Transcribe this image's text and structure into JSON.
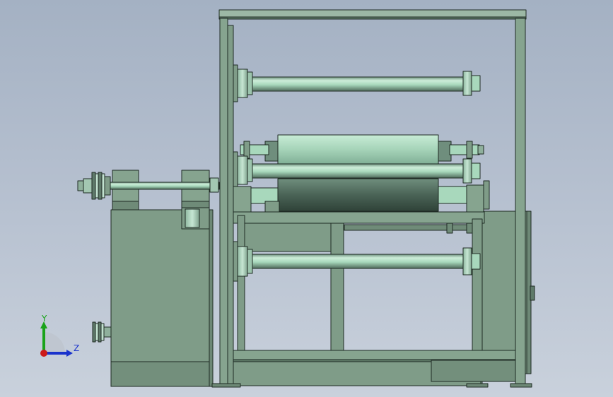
{
  "scene": {
    "name": "slitting-rewinding-machine-side-view"
  },
  "triad": {
    "y_label": "Y",
    "z_label": "Z",
    "colors": {
      "y": "#1aa31a",
      "z": "#1a33cc",
      "x": "#cc1a1a"
    }
  },
  "palette": {
    "body": "#7f9c88",
    "body_dark": "#5e7a67",
    "roller": "#a8d8bc",
    "roller_light": "#cdeed9",
    "roller_dark": "#4f6b5b",
    "outline": "#1f2b24"
  }
}
